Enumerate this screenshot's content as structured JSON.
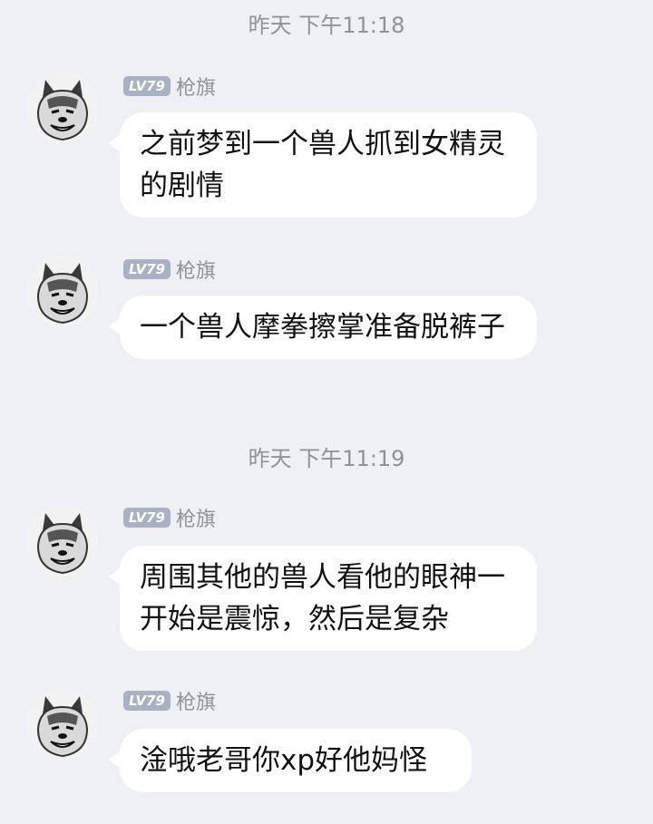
{
  "timestamps": [
    "昨天 下午11:18",
    "昨天 下午11:19"
  ],
  "sender": {
    "level": "LV79",
    "name": "枪旗",
    "avatar_icon": "husky-meme-avatar-icon"
  },
  "messages": [
    {
      "text": "之前梦到一个兽人抓到女精灵的剧情"
    },
    {
      "text": "一个兽人摩拳擦掌准备脱裤子"
    },
    {
      "text": "周围其他的兽人看他的眼神一开始是震惊，然后是复杂"
    },
    {
      "text": "淦哦老哥你xp好他妈怪"
    }
  ],
  "colors": {
    "background": "#eef0f4",
    "bubble": "#ffffff",
    "badge": "#a9b2c4",
    "meta_text": "#8f9299"
  }
}
